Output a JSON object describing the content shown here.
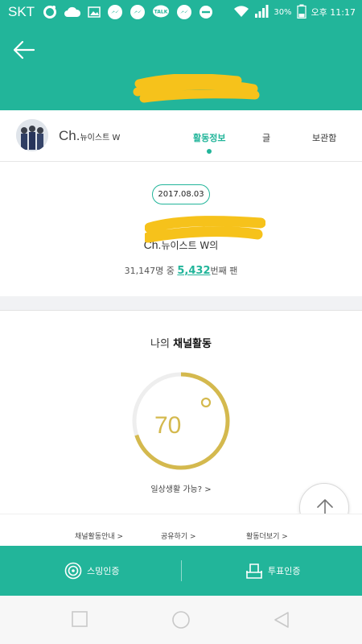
{
  "status_bar": {
    "carrier": "SKT",
    "talk_icon_label": "TALK",
    "battery": "30%",
    "time": "오후 11:17"
  },
  "header": {
    "back_icon": "arrow-left-icon"
  },
  "channel": {
    "prefix": "Ch.",
    "name": "뉴이스트 W",
    "tabs": [
      "활동정보",
      "글",
      "보관함"
    ],
    "active_tab": "활동정보"
  },
  "fan_info": {
    "date": "2017.08.03",
    "name_prefix": "Ch.",
    "name_kr": "뉴이스트 W의",
    "rank_prefix": "31,147명 중",
    "rank_number": "5,432",
    "rank_suffix": "번째 팬"
  },
  "activity": {
    "title_plain": "나의",
    "title_bold": "채널활동",
    "score": "70",
    "score_fraction": 0.7,
    "life_link": "일상생활 가능? >"
  },
  "links": [
    "채널활동안내 >",
    "공유하기 >",
    "활동더보기 >"
  ],
  "actions": {
    "stream": "스밍인증",
    "vote": "투표인증"
  },
  "colors": {
    "brand_green": "#22b59a",
    "gauge_gold": "#d4b94e",
    "redaction_yellow": "#f6c21b"
  }
}
